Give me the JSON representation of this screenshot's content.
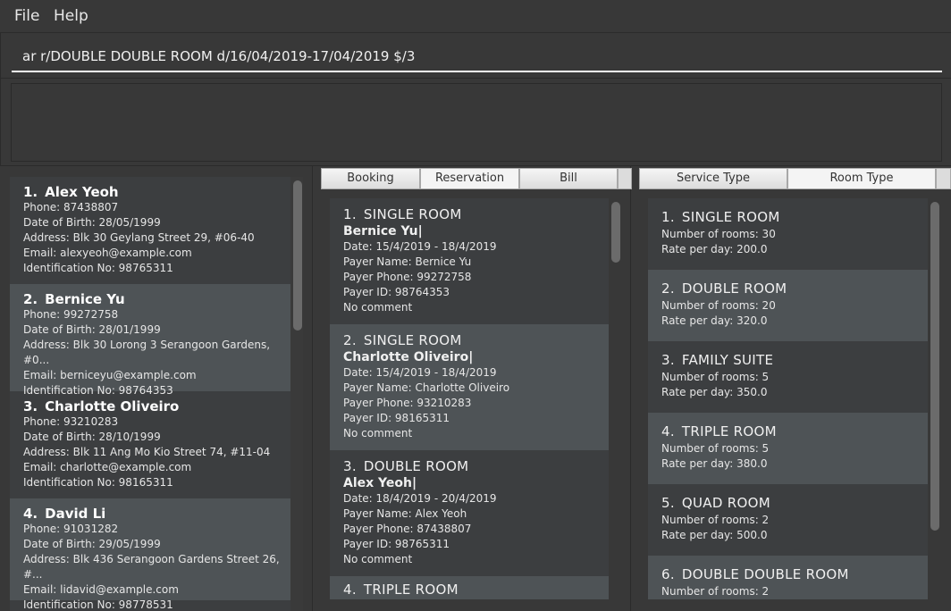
{
  "menu": {
    "file": "File",
    "help": "Help"
  },
  "command": {
    "value": "ar r/DOUBLE DOUBLE ROOM d/16/04/2019-17/04/2019 $/3"
  },
  "result": {
    "text": ""
  },
  "customers": [
    {
      "index": "1.",
      "name": "Alex Yeoh",
      "phone": "Phone: 87438807",
      "dob": "Date of Birth: 28/05/1999",
      "address": "Address: Blk 30 Geylang Street 29, #06-40",
      "email": "Email: alexyeoh@example.com",
      "id": "Identification No: 98765311"
    },
    {
      "index": "2.",
      "name": "Bernice Yu",
      "phone": "Phone: 99272758",
      "dob": "Date of Birth: 28/01/1999",
      "address": "Address: Blk 30 Lorong 3 Serangoon Gardens, #0...",
      "email": "Email: berniceyu@example.com",
      "id": "Identification No: 98764353"
    },
    {
      "index": "3.",
      "name": "Charlotte Oliveiro",
      "phone": "Phone: 93210283",
      "dob": "Date of Birth: 28/10/1999",
      "address": "Address: Blk 11 Ang Mo Kio Street 74, #11-04",
      "email": "Email: charlotte@example.com",
      "id": "Identification No: 98165311"
    },
    {
      "index": "4.",
      "name": "David Li",
      "phone": "Phone: 91031282",
      "dob": "Date of Birth: 29/05/1999",
      "address": "Address: Blk 436 Serangoon Gardens Street 26, #...",
      "email": "Email: lidavid@example.com",
      "id": "Identification No: 98778531"
    }
  ],
  "middle_tabs": [
    {
      "label": "Booking",
      "active": false
    },
    {
      "label": "Reservation",
      "active": true
    },
    {
      "label": "Bill",
      "active": false
    }
  ],
  "reservations": [
    {
      "index": "1.",
      "room": "SINGLE ROOM",
      "guest": "Bernice Yu|",
      "date": "Date: 15/4/2019 - 18/4/2019",
      "payer_name": "Payer Name: Bernice Yu",
      "payer_phone": "Payer Phone: 99272758",
      "payer_id": "Payer ID: 98764353",
      "comment": "No comment"
    },
    {
      "index": "2.",
      "room": "SINGLE ROOM",
      "guest": "Charlotte Oliveiro|",
      "date": "Date: 15/4/2019 - 18/4/2019",
      "payer_name": "Payer Name: Charlotte Oliveiro",
      "payer_phone": "Payer Phone: 93210283",
      "payer_id": "Payer ID: 98165311",
      "comment": "No comment"
    },
    {
      "index": "3.",
      "room": "DOUBLE ROOM",
      "guest": "Alex Yeoh|",
      "date": "Date: 18/4/2019 - 20/4/2019",
      "payer_name": "Payer Name: Alex Yeoh",
      "payer_phone": "Payer Phone: 87438807",
      "payer_id": "Payer ID: 98765311",
      "comment": "No comment"
    },
    {
      "index": "4.",
      "room": "TRIPLE ROOM"
    }
  ],
  "right_tabs": [
    {
      "label": "Service Type",
      "active": false
    },
    {
      "label": "Room Type",
      "active": true
    }
  ],
  "room_types": [
    {
      "index": "1.",
      "name": "SINGLE ROOM",
      "rooms": "Number of rooms: 30",
      "rate": "Rate per day: 200.0"
    },
    {
      "index": "2.",
      "name": "DOUBLE ROOM",
      "rooms": "Number of rooms: 20",
      "rate": "Rate per day: 320.0"
    },
    {
      "index": "3.",
      "name": "FAMILY SUITE",
      "rooms": "Number of rooms: 5",
      "rate": "Rate per day: 350.0"
    },
    {
      "index": "4.",
      "name": "TRIPLE ROOM",
      "rooms": "Number of rooms: 5",
      "rate": "Rate per day: 380.0"
    },
    {
      "index": "5.",
      "name": "QUAD ROOM",
      "rooms": "Number of rooms: 2",
      "rate": "Rate per day: 500.0"
    },
    {
      "index": "6.",
      "name": "DOUBLE DOUBLE ROOM",
      "rooms": "Number of rooms: 2"
    }
  ]
}
